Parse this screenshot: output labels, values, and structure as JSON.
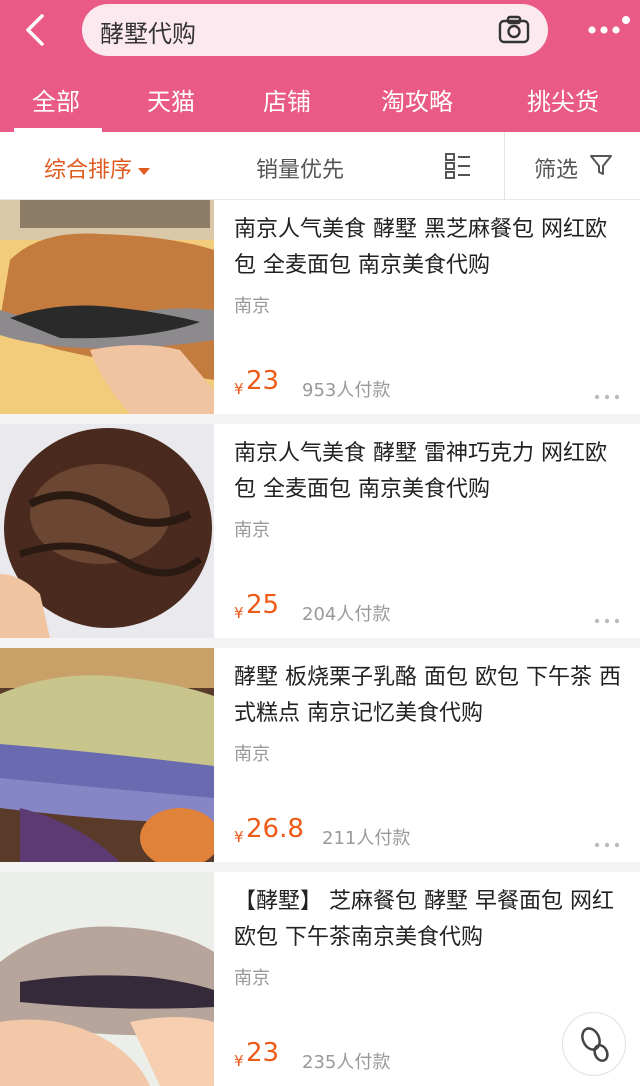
{
  "search": {
    "query": "酵墅代购"
  },
  "tabs": [
    {
      "label": "全部"
    },
    {
      "label": "天猫"
    },
    {
      "label": "店铺"
    },
    {
      "label": "淘攻略"
    },
    {
      "label": "挑尖货"
    }
  ],
  "sortbar": {
    "comprehensive": "综合排序",
    "sales": "销量优先",
    "filter": "筛选"
  },
  "icons": {
    "back": "back-icon",
    "camera": "camera-icon",
    "more": "more-icon",
    "list_view": "list-view-icon",
    "filter": "filter-icon",
    "item_more": "more-dots-icon",
    "footprint": "footprint-icon"
  },
  "colors": {
    "header": "#ea5a86",
    "accent": "#e05a1f",
    "price": "#ef5a17"
  },
  "products": [
    {
      "title": "南京人气美食 酵墅 黑芝麻餐包 网红欧包 全麦面包 南京美食代购",
      "location": "南京",
      "currency": "¥",
      "price": "23",
      "buyers": "953人付款"
    },
    {
      "title": "南京人气美食 酵墅 雷神巧克力 网红欧包 全麦面包 南京美食代购",
      "location": "南京",
      "currency": "¥",
      "price": "25",
      "buyers": "204人付款"
    },
    {
      "title": "酵墅 板烧栗子乳酪 面包 欧包 下午茶 西式糕点 南京记忆美食代购",
      "location": "南京",
      "currency": "¥",
      "price": "26.8",
      "buyers": "211人付款"
    },
    {
      "title": "【酵墅】 芝麻餐包 酵墅 早餐面包 网红欧包 下午茶南京美食代购",
      "location": "南京",
      "currency": "¥",
      "price": "23",
      "buyers": "235人付款"
    }
  ]
}
